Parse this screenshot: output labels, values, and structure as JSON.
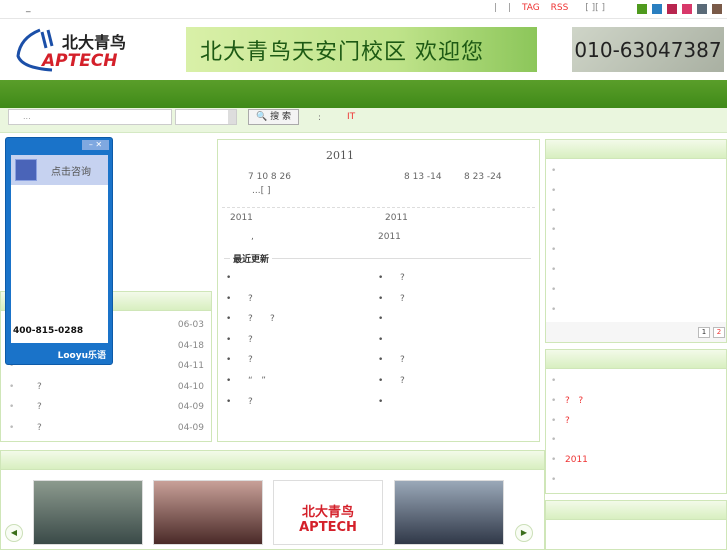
{
  "topbar": {
    "dash": "_",
    "sep1": "|",
    "sep2": "|",
    "tag": "TAG",
    "rss": "RSS",
    "brackets": "[ ][ ]",
    "skins": [
      "#4f9a1e",
      "#2a7fc0",
      "#b8254f",
      "#d8386a",
      "#5a6a78",
      "#7a5a48"
    ]
  },
  "header": {
    "logo_text": "北大青鸟 APTECH",
    "banner_text": "北大青鸟天安门校区 欢迎您",
    "phone": "010-63047387"
  },
  "search": {
    "placeholder": "...",
    "button": "搜 索",
    "colon": ":",
    "it": "IT"
  },
  "chat": {
    "title": "点击咨询",
    "phone": "400-815-0288",
    "brand": "Looyu乐语"
  },
  "left_list": [
    {
      "t": "",
      "d": "06-03"
    },
    {
      "t": "",
      "d": "04-18"
    },
    {
      "t": "",
      "d": "04-11"
    },
    {
      "t": "?",
      "d": "04-10"
    },
    {
      "t": "?",
      "d": "04-09"
    },
    {
      "t": "?",
      "d": "04-09"
    }
  ],
  "center": {
    "headline": "2011",
    "summary_a": "7 10   8 26",
    "summary_b": "8 13 -14",
    "summary_c": "8 23 -24",
    "more": "...[  ]",
    "news": [
      {
        "l": "2011",
        "r": "2011"
      },
      {
        "l": ",",
        "r": "2011"
      }
    ],
    "recent_title": "最近更新",
    "recent_left": [
      "",
      "?",
      "?      ?",
      "?",
      "?",
      "“   ”",
      "?"
    ],
    "recent_right": [
      "?",
      "?",
      "",
      "",
      "?",
      "?",
      ""
    ]
  },
  "right1": {
    "count": 8,
    "pages": [
      "1",
      "2"
    ]
  },
  "right2": {
    "items": [
      "",
      "?   ?",
      "?",
      "",
      "2011",
      ""
    ]
  },
  "slider": {
    "prev": "◀",
    "next": "▶",
    "thumb3": "北大青鸟 APTECH"
  }
}
